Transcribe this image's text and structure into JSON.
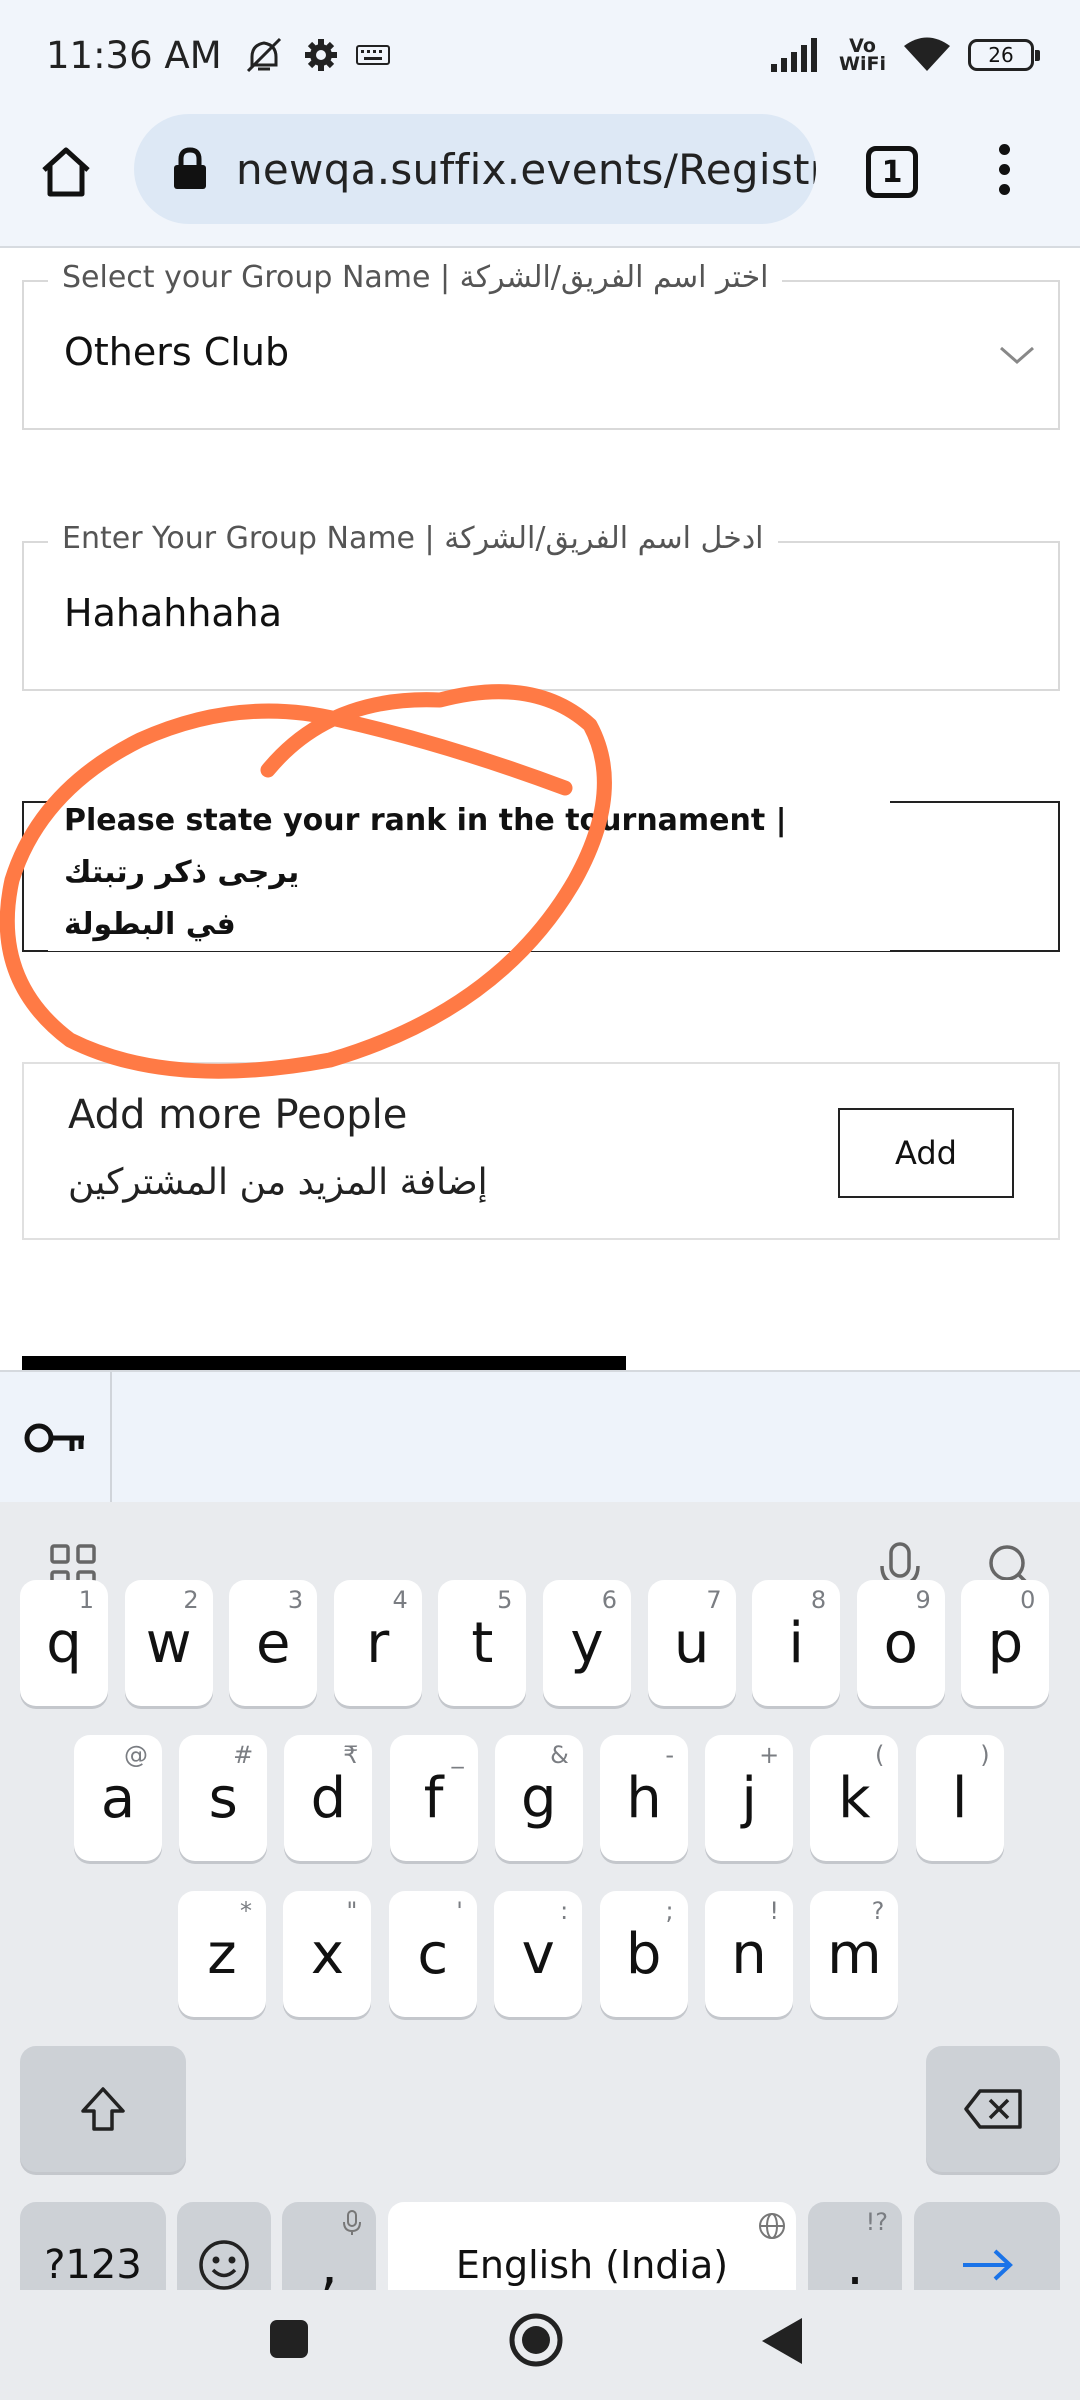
{
  "status_bar": {
    "time": "11:36 AM",
    "vowifi_top": "Vo",
    "vowifi_bottom": "WiFi",
    "battery": "26",
    "icons": [
      "mute-icon",
      "settings-icon",
      "keyboard-icon",
      "signal-icon",
      "wifi-icon",
      "battery-icon"
    ]
  },
  "browser": {
    "url": "newqa.suffix.events/Registration",
    "tab_count": "1"
  },
  "form": {
    "group_select": {
      "label": "Select your Group Name  |  اختر اسم الفريق/الشركة",
      "value": "Others Club"
    },
    "group_input": {
      "label": "Enter Your Group Name | ادخل اسم الفريق/الشركة",
      "value": "Hahahhaha"
    },
    "rank_field": {
      "label_line1": "Please state your rank in the tournament | يرجى ذكر رتبتك",
      "label_line2": "في البطولة"
    },
    "add_people": {
      "title": "Add more People",
      "subtitle": "إضافة المزيد من المشتركين",
      "button": "Add"
    }
  },
  "annotation_color": "#ff7a45",
  "keyboard": {
    "row1": [
      {
        "k": "q",
        "h": "1"
      },
      {
        "k": "w",
        "h": "2"
      },
      {
        "k": "e",
        "h": "3"
      },
      {
        "k": "r",
        "h": "4"
      },
      {
        "k": "t",
        "h": "5"
      },
      {
        "k": "y",
        "h": "6"
      },
      {
        "k": "u",
        "h": "7"
      },
      {
        "k": "i",
        "h": "8"
      },
      {
        "k": "o",
        "h": "9"
      },
      {
        "k": "p",
        "h": "0"
      }
    ],
    "row2": [
      {
        "k": "a",
        "h": "@"
      },
      {
        "k": "s",
        "h": "#"
      },
      {
        "k": "d",
        "h": "₹"
      },
      {
        "k": "f",
        "h": "_"
      },
      {
        "k": "g",
        "h": "&"
      },
      {
        "k": "h",
        "h": "-"
      },
      {
        "k": "j",
        "h": "+"
      },
      {
        "k": "k",
        "h": "("
      },
      {
        "k": "l",
        "h": ")"
      }
    ],
    "row3": [
      {
        "k": "z",
        "h": "*"
      },
      {
        "k": "x",
        "h": "\""
      },
      {
        "k": "c",
        "h": "'"
      },
      {
        "k": "v",
        "h": ":"
      },
      {
        "k": "b",
        "h": ";"
      },
      {
        "k": "n",
        "h": "!"
      },
      {
        "k": "m",
        "h": "?"
      }
    ],
    "sym_key": "?123",
    "comma": ",",
    "space": "English (India)",
    "period": ".",
    "period_hint": "!?"
  }
}
